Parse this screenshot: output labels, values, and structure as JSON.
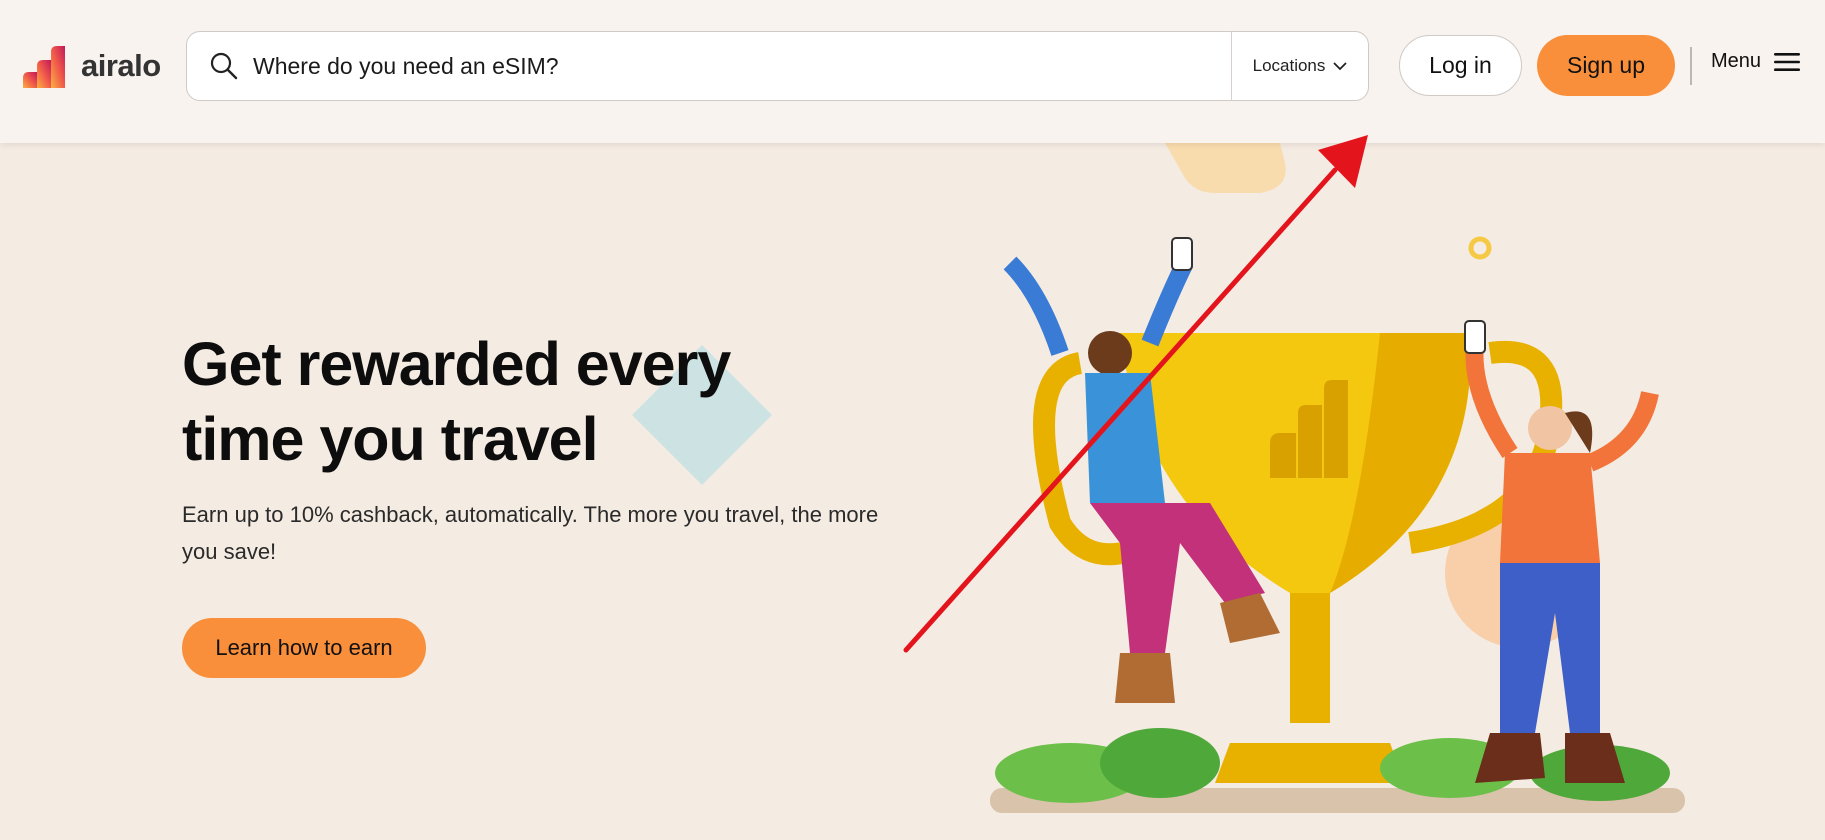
{
  "header": {
    "logo_text": "airalo",
    "search": {
      "placeholder": "Where do you need an eSIM?"
    },
    "locations_label": "Locations",
    "login_label": "Log in",
    "signup_label": "Sign up",
    "menu_label": "Menu"
  },
  "hero": {
    "title_line1": "Get rewarded every",
    "title_line2": "time you travel",
    "subtitle_line1": "Earn up to 10% cashback, automatically. The more you travel, the more",
    "subtitle_line2": "you save!",
    "cta_label": "Learn how to earn"
  },
  "colors": {
    "accent": "#f98f3a",
    "background": "#f4ebe2",
    "header_bg": "#f8f3ef",
    "annotation": "#e4141c"
  },
  "icons": [
    "airalo-logo-icon",
    "search-icon",
    "chevron-down-icon",
    "hamburger-icon",
    "trophy-illustration",
    "red-arrow-annotation"
  ]
}
